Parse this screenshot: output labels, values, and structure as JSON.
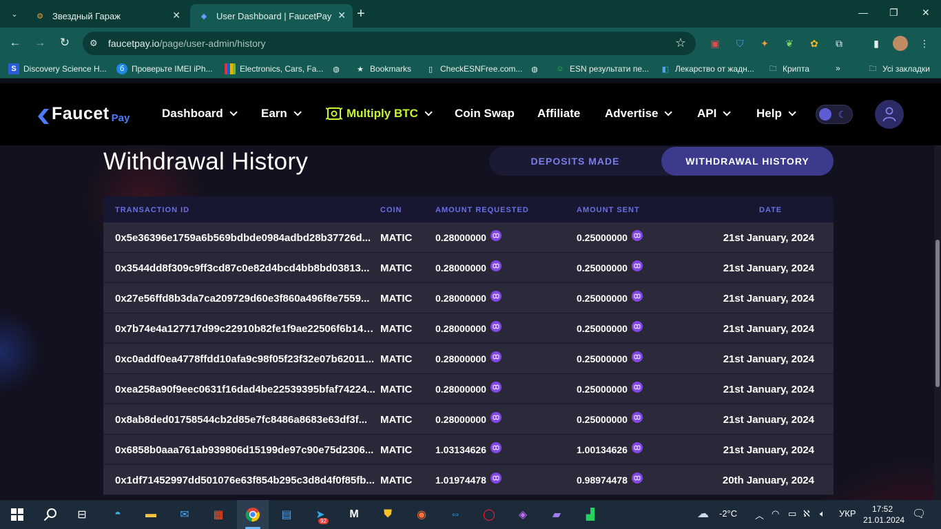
{
  "browser": {
    "tabs": [
      {
        "title": "Звездный Гараж",
        "active": false
      },
      {
        "title": "User Dashboard | FaucetPay",
        "active": true
      }
    ],
    "url_host": "faucetpay.io",
    "url_path": "/page/user-admin/history",
    "bookmarks": [
      "Discovery Science H...",
      "Проверьте IMEI iPh...",
      "Electronics, Cars, Fa...",
      "Bookmarks",
      "CheckESNFree.com...",
      "ESN результати пе...",
      "Лекарство от жадн...",
      "Крипта",
      "Усі закладки"
    ],
    "overflow_label": "»"
  },
  "site": {
    "logo_main": "Faucet",
    "logo_sub": "Pay",
    "nav": {
      "dashboard": "Dashboard",
      "earn": "Earn",
      "multiply": "Multiply BTC",
      "coin_swap": "Coin Swap",
      "affiliate": "Affiliate",
      "advertise": "Advertise",
      "api": "API",
      "help": "Help"
    }
  },
  "page": {
    "title": "Withdrawal History",
    "segments": {
      "deposits": "DEPOSITS MADE",
      "withdrawals": "WITHDRAWAL HISTORY"
    }
  },
  "table": {
    "headers": {
      "txid": "TRANSACTION ID",
      "coin": "COIN",
      "amount_requested": "AMOUNT REQUESTED",
      "amount_sent": "AMOUNT SENT",
      "date": "DATE"
    },
    "rows": [
      {
        "txid": "0x5e36396e1759a6b569bdbde0984adbd28b37726d...",
        "coin": "MATIC",
        "amount_requested": "0.28000000",
        "amount_sent": "0.25000000",
        "date": "21st January, 2024"
      },
      {
        "txid": "0x3544dd8f309c9ff3cd87c0e82d4bcd4bb8bd03813...",
        "coin": "MATIC",
        "amount_requested": "0.28000000",
        "amount_sent": "0.25000000",
        "date": "21st January, 2024"
      },
      {
        "txid": "0x27e56ffd8b3da7ca209729d60e3f860a496f8e7559...",
        "coin": "MATIC",
        "amount_requested": "0.28000000",
        "amount_sent": "0.25000000",
        "date": "21st January, 2024"
      },
      {
        "txid": "0x7b74e4a127717d99c22910b82fe1f9ae22506f6b143...",
        "coin": "MATIC",
        "amount_requested": "0.28000000",
        "amount_sent": "0.25000000",
        "date": "21st January, 2024"
      },
      {
        "txid": "0xc0addf0ea4778ffdd10afa9c98f05f23f32e07b62011...",
        "coin": "MATIC",
        "amount_requested": "0.28000000",
        "amount_sent": "0.25000000",
        "date": "21st January, 2024"
      },
      {
        "txid": "0xea258a90f9eec0631f16dad4be22539395bfaf74224...",
        "coin": "MATIC",
        "amount_requested": "0.28000000",
        "amount_sent": "0.25000000",
        "date": "21st January, 2024"
      },
      {
        "txid": "0x8ab8ded01758544cb2d85e7fc8486a8683e63df3f...",
        "coin": "MATIC",
        "amount_requested": "0.28000000",
        "amount_sent": "0.25000000",
        "date": "21st January, 2024"
      },
      {
        "txid": "0x6858b0aaa761ab939806d15199de97c90e75d2306...",
        "coin": "MATIC",
        "amount_requested": "1.03134626",
        "amount_sent": "1.00134626",
        "date": "21st January, 2024"
      },
      {
        "txid": "0x1df71452997dd501076e63f854b295c3d8d4f0f85fb...",
        "coin": "MATIC",
        "amount_requested": "1.01974478",
        "amount_sent": "0.98974478",
        "date": "20th January, 2024"
      }
    ]
  },
  "taskbar": {
    "telegram_badge": "92",
    "weather": "-2°C",
    "language": "УКР",
    "time": "17:52",
    "date": "21.01.2024"
  },
  "colors": {
    "accent": "#3b3a8c",
    "header_text": "#6b6fe4",
    "multiply": "#c5f534",
    "matic": "#8247e5",
    "chrome_bg": "#145a52"
  }
}
